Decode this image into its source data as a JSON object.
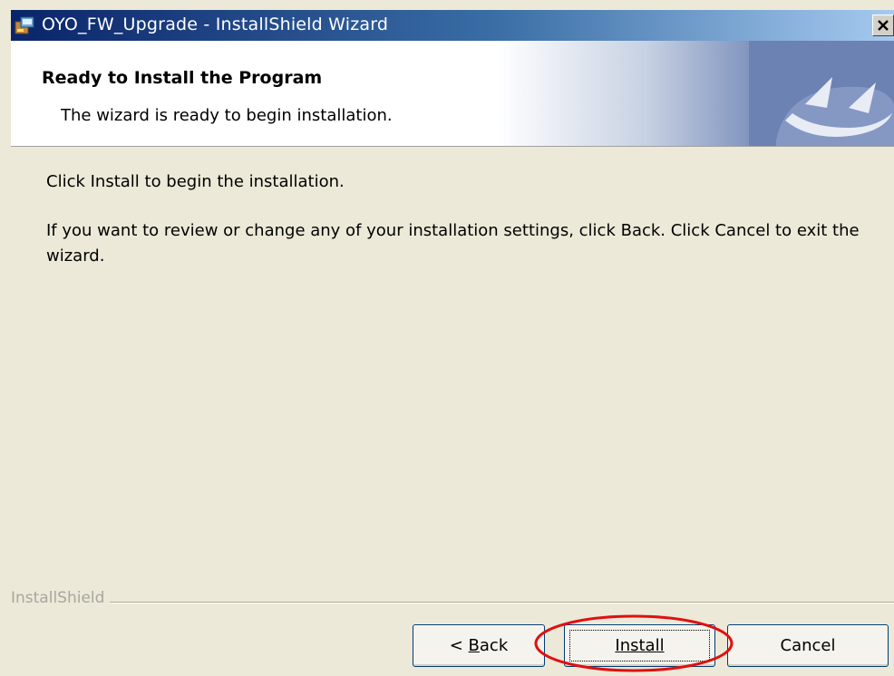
{
  "window": {
    "title": "OYO_FW_Upgrade - InstallShield Wizard",
    "close_label": "×"
  },
  "header": {
    "title": "Ready to Install the Program",
    "subtitle": "The wizard is ready to begin installation."
  },
  "body": {
    "line1": "Click Install to begin the installation.",
    "line2": "If you want to review or change any of your installation settings, click Back. Click Cancel to exit the wizard."
  },
  "footer": {
    "brand": "InstallShield",
    "buttons": {
      "back_prefix": "< ",
      "back_mnemonic": "B",
      "back_rest": "ack",
      "install_mnemonic": "I",
      "install_rest": "nstall",
      "cancel": "Cancel"
    }
  },
  "colors": {
    "annotation": "#e01010",
    "titlebar_start": "#0a246a",
    "dialog_bg": "#ece9d8"
  },
  "icons": {
    "title": "installer-icon",
    "banner": "installshield-logo-icon",
    "close": "close-icon"
  }
}
